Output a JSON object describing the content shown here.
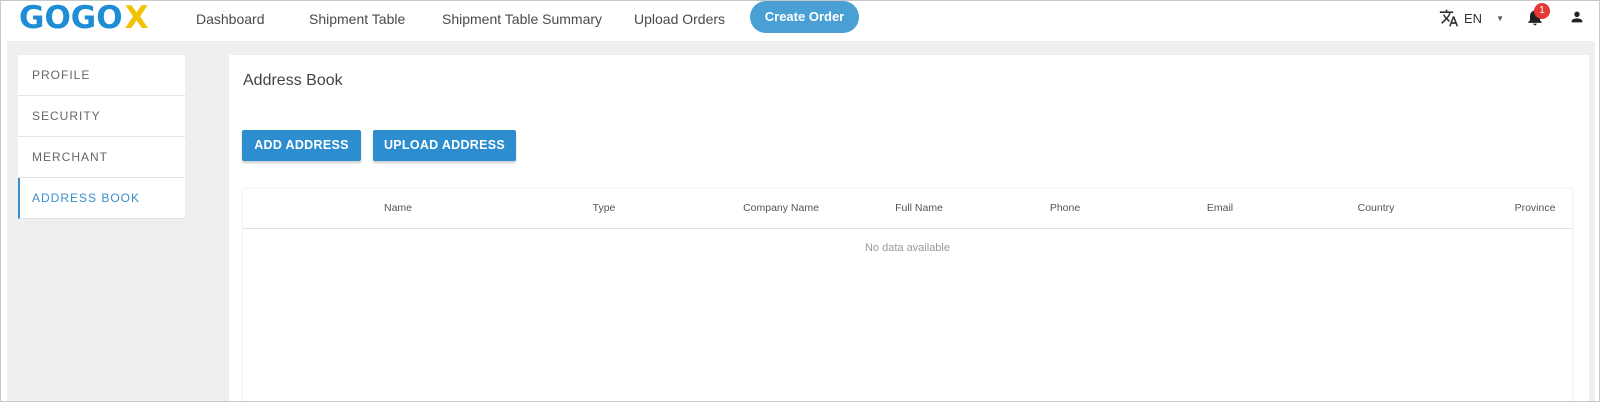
{
  "logo": {
    "text": "GOGO",
    "x": "X"
  },
  "nav": {
    "links": [
      "Dashboard",
      "Shipment Table",
      "Shipment Table Summary",
      "Upload Orders"
    ],
    "create_order": "Create Order"
  },
  "header": {
    "language": "EN",
    "notification_count": "1",
    "icons": [
      "translate-icon",
      "bell-icon",
      "user-icon"
    ]
  },
  "sidebar": {
    "items": [
      {
        "label": "PROFILE",
        "active": false
      },
      {
        "label": "SECURITY",
        "active": false
      },
      {
        "label": "MERCHANT",
        "active": false
      },
      {
        "label": "ADDRESS BOOK",
        "active": true
      }
    ]
  },
  "main": {
    "title": "Address Book",
    "add_address": "ADD ADDRESS",
    "upload_address": "UPLOAD ADDRESS",
    "table": {
      "columns": [
        "Name",
        "Type",
        "Company Name",
        "Full Name",
        "Phone",
        "Email",
        "Country",
        "Province"
      ],
      "empty_text": "No data available"
    }
  },
  "colors": {
    "accent": "#2c8ecf",
    "logo_blue": "#1f8dd6",
    "logo_yellow": "#f2c200",
    "badge": "#e53935"
  }
}
